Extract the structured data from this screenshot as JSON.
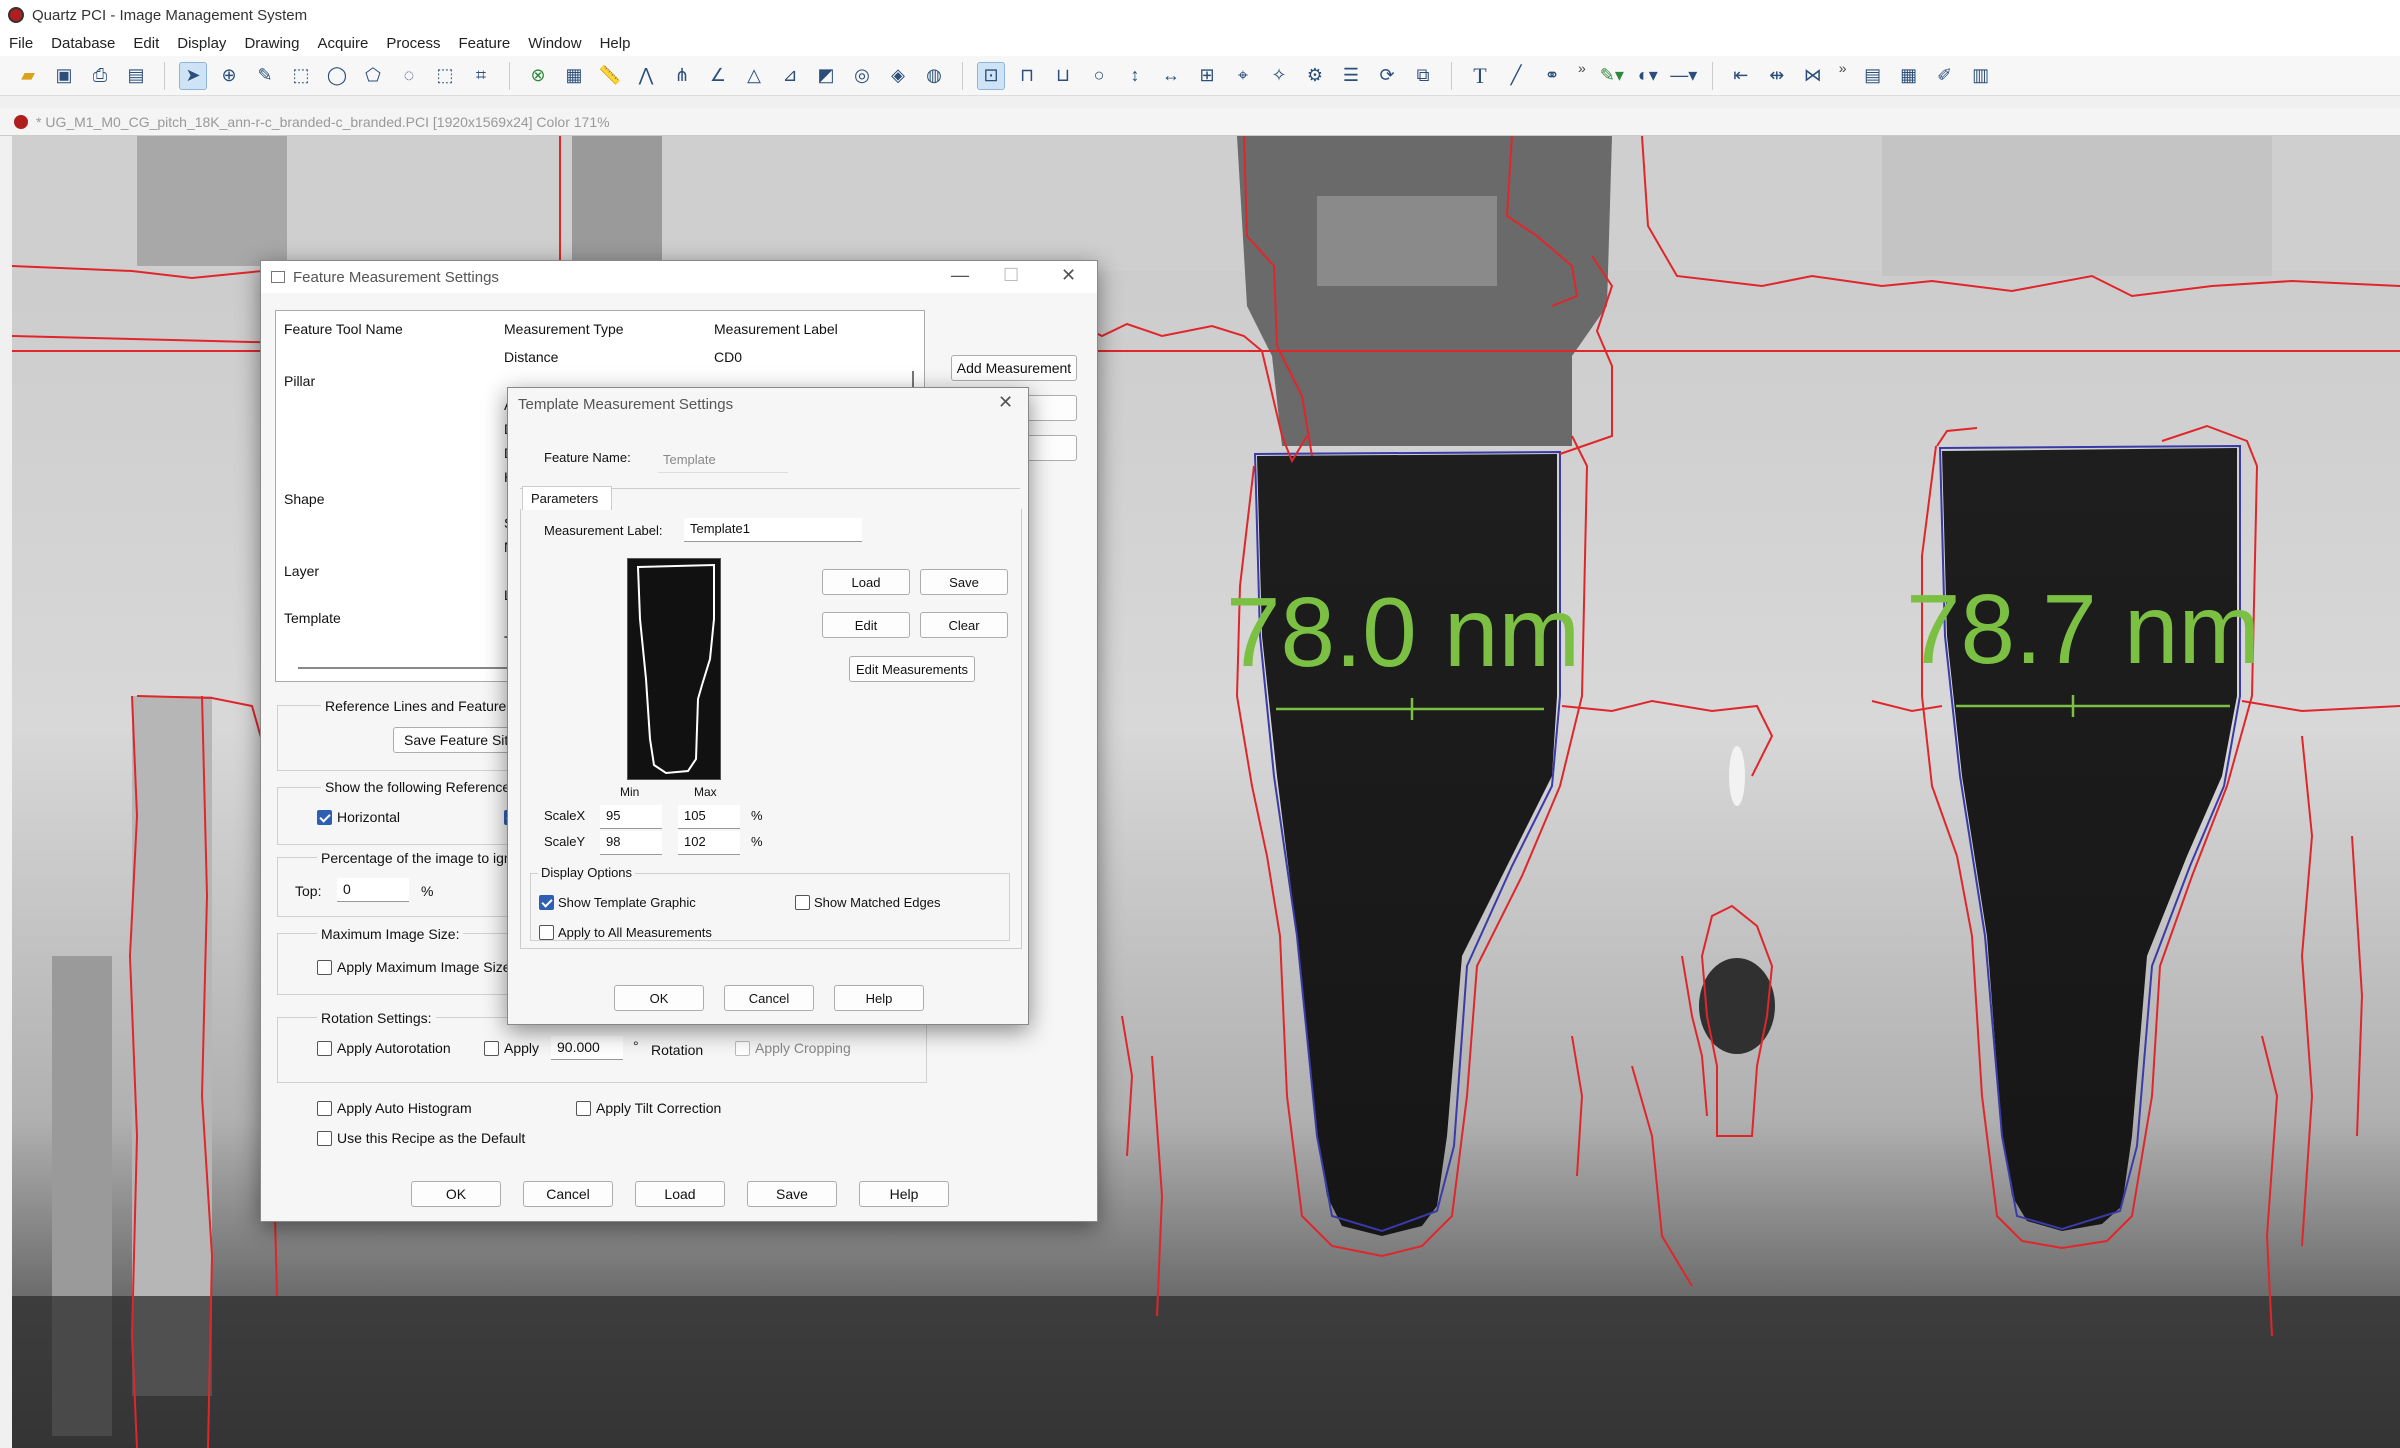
{
  "app": {
    "title": "Quartz PCI - Image Management System"
  },
  "menu": [
    "File",
    "Database",
    "Edit",
    "Display",
    "Drawing",
    "Acquire",
    "Process",
    "Feature",
    "Window",
    "Help"
  ],
  "document_tab": "* UG_M1_M0_CG_pitch_18K_ann-r-c_branded-c_branded.PCI [1920x1569x24] Color 171%",
  "toolbar": {
    "more": "»"
  },
  "image": {
    "measurement_left": "78.0 nm",
    "measurement_right": "78.7 nm",
    "colors": {
      "edge": "#e0262a",
      "template": "#3a3aa8",
      "measure": "#7bc043"
    }
  },
  "feature_dialog": {
    "title": "Feature Measurement Settings",
    "columns": [
      "Feature Tool Name",
      "Measurement Type",
      "Measurement Label"
    ],
    "rows": [
      {
        "tool": "",
        "type": "Distance",
        "label": "CD0"
      },
      {
        "tool": "Pillar",
        "type": "",
        "label": ""
      },
      {
        "tool": "",
        "type": "A",
        "label": ""
      },
      {
        "tool": "",
        "type": "D",
        "label": ""
      },
      {
        "tool": "",
        "type": "D",
        "label": ""
      },
      {
        "tool": "",
        "type": "H",
        "label": ""
      },
      {
        "tool": "Shape",
        "type": "",
        "label": ""
      },
      {
        "tool": "",
        "type": "S",
        "label": ""
      },
      {
        "tool": "",
        "type": "N",
        "label": ""
      },
      {
        "tool": "Layer",
        "type": "",
        "label": ""
      },
      {
        "tool": "",
        "type": "L",
        "label": ""
      },
      {
        "tool": "Template",
        "type": "",
        "label": ""
      },
      {
        "tool": "",
        "type": "T",
        "label": ""
      }
    ],
    "add_measurement": "Add Measurement",
    "side_btn2": "e",
    "ref_group": "Reference Lines and Feature Si",
    "save_feature": "Save Feature Sit",
    "show_refs": "Show the following References",
    "horizontal": "Horizontal",
    "pct_group": "Percentage of the image to ign",
    "top_label": "Top:",
    "top_value": "0",
    "pct": "%",
    "max_size_group": "Maximum Image Size:",
    "apply_max": "Apply Maximum Image Size",
    "rotation_group": "Rotation Settings:",
    "apply_autorot": "Apply Autorotation",
    "apply": "Apply",
    "rotation_value": "90.000",
    "degree": "°",
    "rotation": "Rotation",
    "apply_cropping": "Apply Cropping",
    "auto_hist": "Apply Auto Histogram",
    "tilt": "Apply Tilt Correction",
    "default_recipe": "Use this Recipe as the Default",
    "buttons": [
      "OK",
      "Cancel",
      "Load",
      "Save",
      "Help"
    ]
  },
  "template_dialog": {
    "title": "Template Measurement Settings",
    "feature_name_label": "Feature Name:",
    "feature_name_value": "Template",
    "tab": "Parameters",
    "measurement_label": "Measurement Label:",
    "measurement_value": "Template1",
    "load": "Load",
    "save": "Save",
    "edit": "Edit",
    "clear": "Clear",
    "edit_measurements": "Edit Measurements",
    "min": "Min",
    "max": "Max",
    "scalex": "ScaleX",
    "scalex_min": "95",
    "scalex_max": "105",
    "scaley": "ScaleY",
    "scaley_min": "98",
    "scaley_max": "102",
    "pct": "%",
    "display_options": "Display Options",
    "show_graphic": "Show Template Graphic",
    "show_edges": "Show Matched Edges",
    "apply_all": "Apply to All Measurements",
    "ok": "OK",
    "cancel": "Cancel",
    "help": "Help"
  }
}
